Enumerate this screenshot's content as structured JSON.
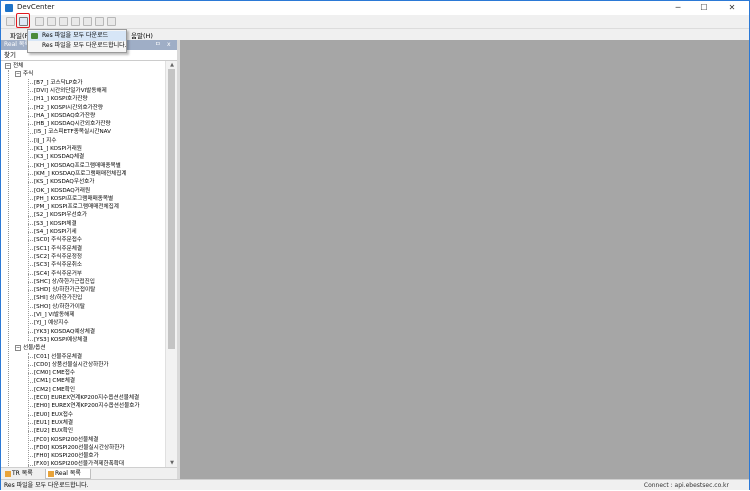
{
  "window": {
    "title": "DevCenter",
    "minimize_glyph": "─",
    "maximize_glyph": "☐",
    "close_glyph": "✕"
  },
  "menubar": {
    "file": "파일(F)",
    "help": "움말(H)"
  },
  "file_menu": {
    "items": [
      {
        "label": "Res 파일을 모두 다운로드",
        "icon": "download-icon"
      },
      {
        "label": "Res 파일을 모두 다운로드합니다."
      }
    ]
  },
  "panel": {
    "header": "Real 목록",
    "pin_glyph": "ㅁ",
    "close_glyph": "x",
    "search_label": "찾기"
  },
  "tree": {
    "root": "전체",
    "groups": [
      {
        "label": "주식",
        "expander": "−",
        "items": [
          "[B7_] 코스닥LP호가",
          "[DVI] 시간외단일가VI발동해제",
          "[H1_] KOSPI호가잔량",
          "[H2_] KOSPI시간외호가잔량",
          "[HA_] KOSDAQ호가잔량",
          "[HB_] KOSDAQ시간외호가잔량",
          "[I5_] 코스피ETF종목실시간NAV",
          "[IJ_] 지수",
          "[K1_] KOSPI거래원",
          "[K3_] KOSDAQ체결",
          "[KH_] KOSDAQ프로그램매매종목별",
          "[KM_] KOSDAQ프로그램매매전체집계",
          "[KS_] KOSDAQ우선호가",
          "[OK_] KOSDAQ거래원",
          "[PH_] KOSPI프로그램매매종목별",
          "[PM_] KOSPI프로그램매매전체집계",
          "[S2_] KOSPI우선호가",
          "[S3_] KOSPI체결",
          "[S4_] KOSPI기세",
          "[SC0] 주식주문접수",
          "[SC1] 주식주문체결",
          "[SC2] 주식주문정정",
          "[SC3] 주식주문취소",
          "[SC4] 주식주문거부",
          "[SHC] 상/하한가근접진입",
          "[SHD] 상/하한가근접이탈",
          "[SHI] 상/하한가진입",
          "[SHO] 상/하한가이탈",
          "[VI_] VI발동해제",
          "[YJ_] 예상지수",
          "[YK3] KOSDAQ예상체결",
          "[YS3] KOSPI예상체결"
        ]
      },
      {
        "label": "선물/옵션",
        "expander": "−",
        "items": [
          "[C01] 선물주문체결",
          "[CD0] 상품선물실시간상하한가",
          "[CM0] CME접수",
          "[CM1] CME체결",
          "[CM2] CME확인",
          "[EC0] EUREX연계KP200지수옵션선물체결",
          "[EH0] EUREX연계KP200지수옵션선물호가",
          "[EU0] EUX접수",
          "[EU1] EUX체결",
          "[EU2] EUX확인",
          "[FC0] KOSPI200선물체결",
          "[FD0] KOSPI200선물실시간상하한가",
          "[FH0] KOSPI200선물호가",
          "[FX0] KOSPI200선물가격제한폭확대",
          "[H01] 선물주문정정취소",
          "[HC0] 상품선물체결"
        ]
      }
    ]
  },
  "bottom_tabs": [
    {
      "label": "TR 목록"
    },
    {
      "label": "Real 목록"
    }
  ],
  "statusbar": {
    "left": "Res 파일을 모두 다운로드합니다.",
    "right": "Connect : api.ebestsec.co.kr"
  },
  "colors": {
    "panel_header": "#9faec6",
    "content_bg": "#a6a6a6",
    "highlight": "#e0181e",
    "window_border": "#2b79d6"
  }
}
